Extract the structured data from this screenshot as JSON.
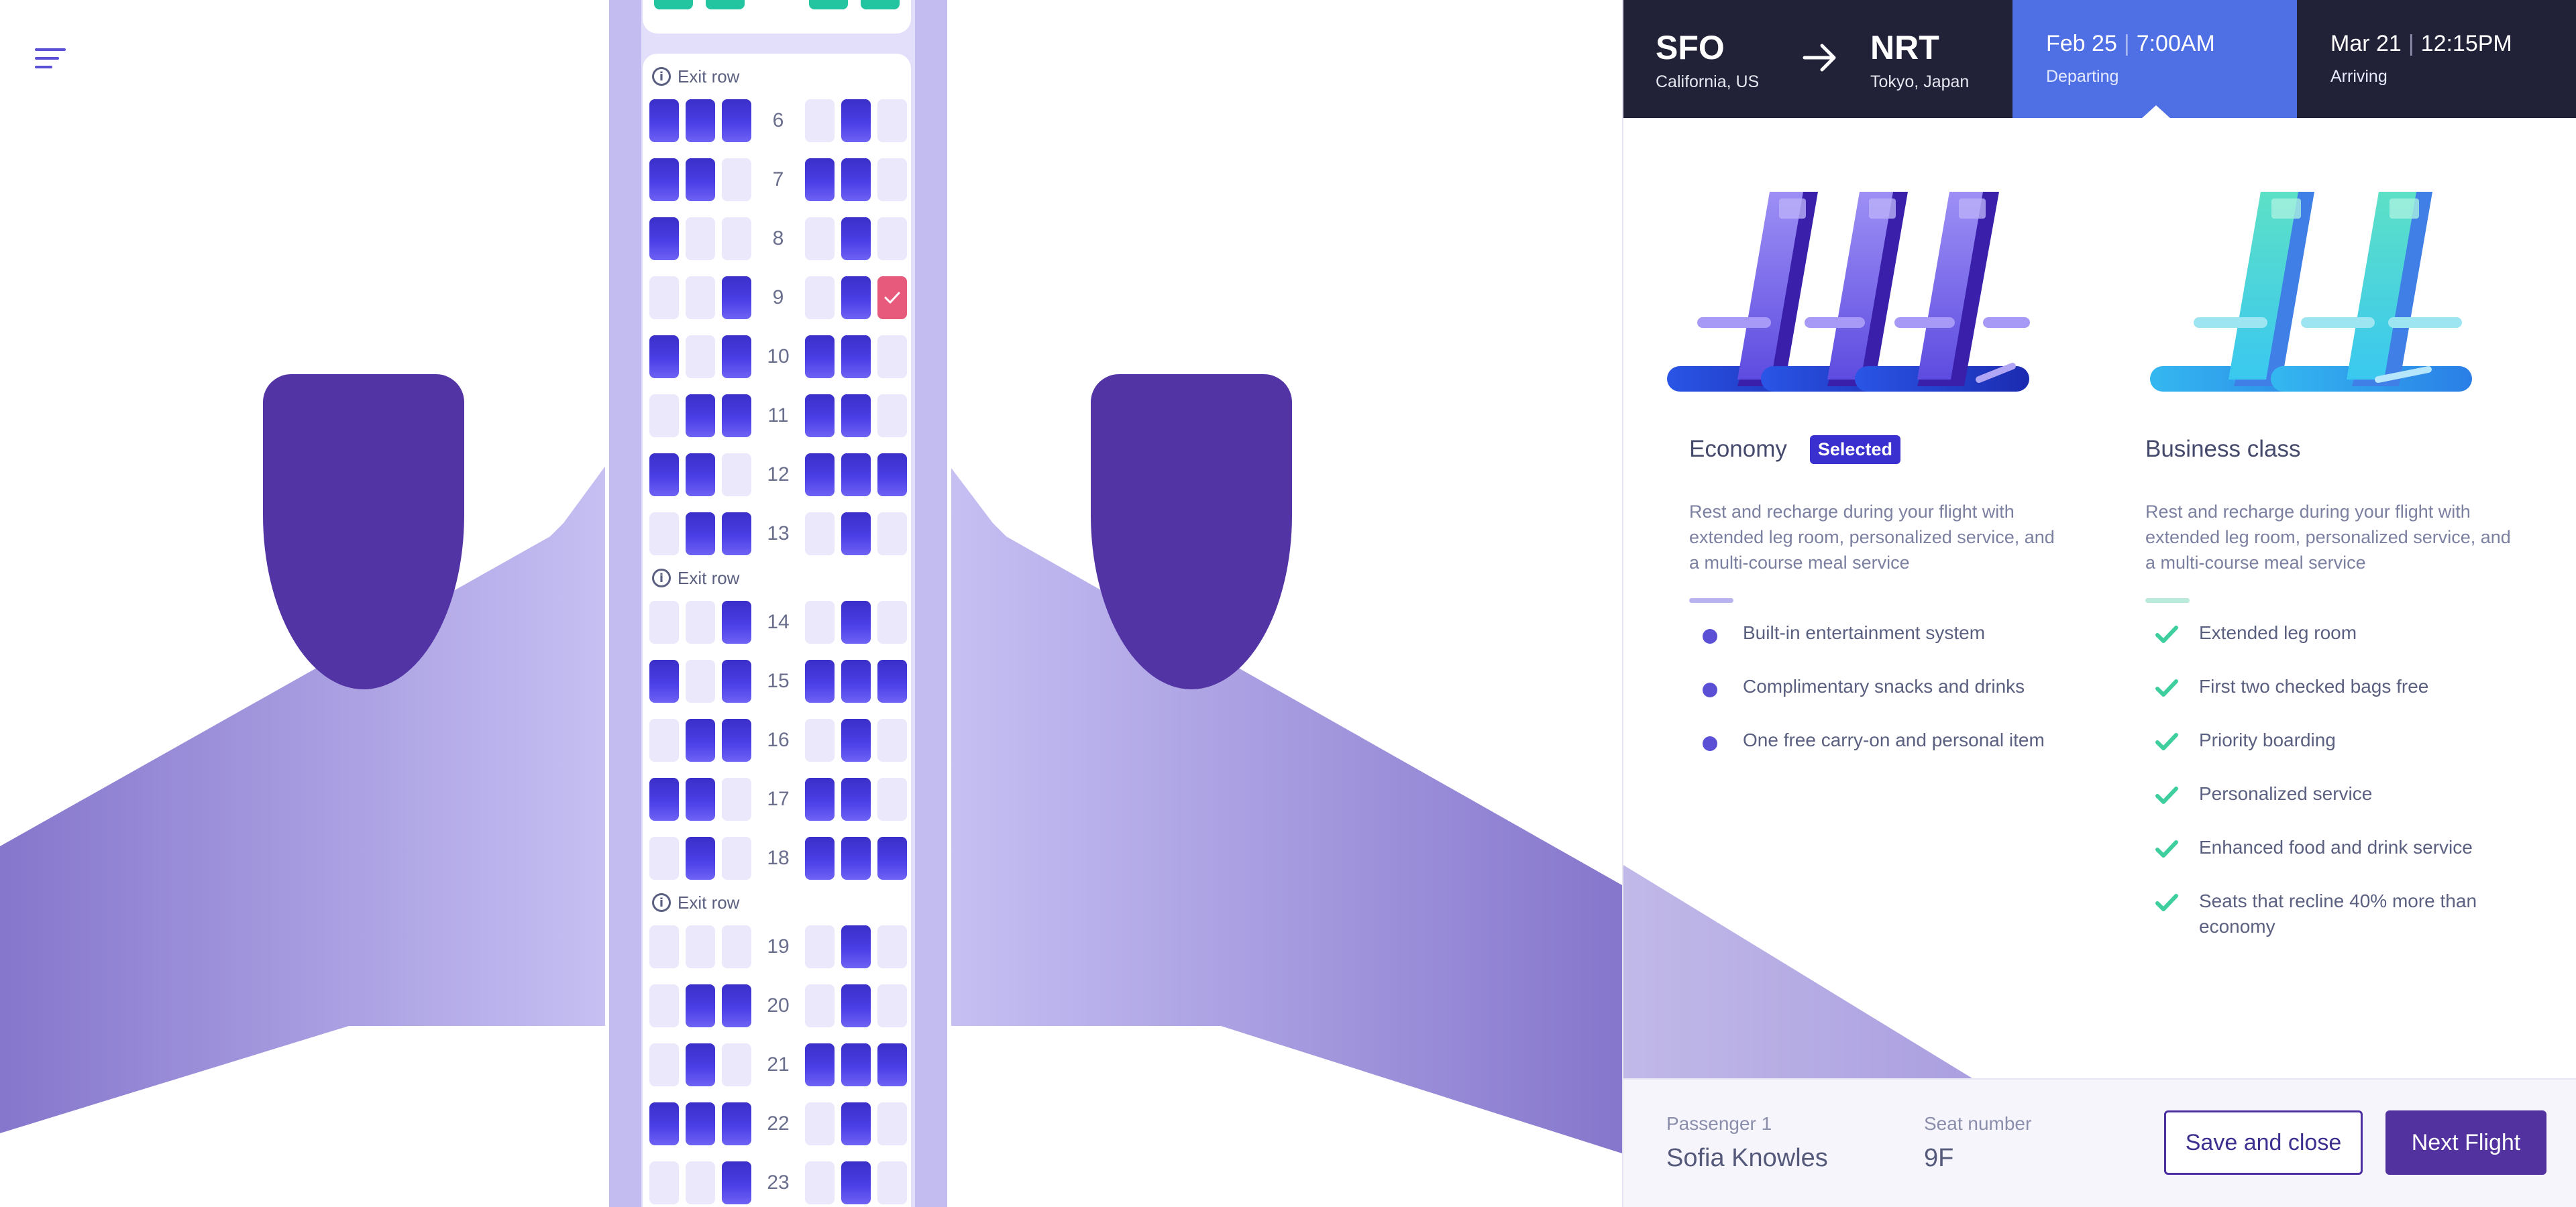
{
  "menu": {
    "icon": "hamburger-menu-icon"
  },
  "seat_map": {
    "exit_label": "Exit row",
    "selected_mark_icon": "check-icon",
    "colors": {
      "taken": "#4a3ee6",
      "free": "#ebe8fb",
      "selected": "#e85a7c",
      "exit_mini_seats": "#23c5a0"
    },
    "rows": [
      {
        "num": "6",
        "seats": [
          "T",
          "T",
          "T",
          "F",
          "T",
          "F"
        ]
      },
      {
        "num": "7",
        "seats": [
          "T",
          "T",
          "F",
          "T",
          "T",
          "F"
        ]
      },
      {
        "num": "8",
        "seats": [
          "T",
          "F",
          "F",
          "F",
          "T",
          "F"
        ]
      },
      {
        "num": "9",
        "seats": [
          "F",
          "F",
          "T",
          "F",
          "T",
          "S"
        ]
      },
      {
        "num": "10",
        "seats": [
          "T",
          "F",
          "T",
          "T",
          "T",
          "F"
        ]
      },
      {
        "num": "11",
        "seats": [
          "F",
          "T",
          "T",
          "T",
          "T",
          "F"
        ]
      },
      {
        "num": "12",
        "seats": [
          "T",
          "T",
          "F",
          "T",
          "T",
          "T"
        ]
      },
      {
        "num": "13",
        "seats": [
          "F",
          "T",
          "T",
          "F",
          "T",
          "F"
        ]
      },
      {
        "num": "14",
        "seats": [
          "F",
          "F",
          "T",
          "F",
          "T",
          "F"
        ]
      },
      {
        "num": "15",
        "seats": [
          "T",
          "F",
          "T",
          "T",
          "T",
          "T"
        ]
      },
      {
        "num": "16",
        "seats": [
          "F",
          "T",
          "T",
          "F",
          "T",
          "F"
        ]
      },
      {
        "num": "17",
        "seats": [
          "T",
          "T",
          "F",
          "T",
          "T",
          "F"
        ]
      },
      {
        "num": "18",
        "seats": [
          "F",
          "T",
          "F",
          "T",
          "T",
          "T"
        ]
      },
      {
        "num": "19",
        "seats": [
          "F",
          "F",
          "F",
          "F",
          "T",
          "F"
        ]
      },
      {
        "num": "20",
        "seats": [
          "F",
          "T",
          "T",
          "F",
          "T",
          "F"
        ]
      },
      {
        "num": "21",
        "seats": [
          "F",
          "T",
          "F",
          "T",
          "T",
          "T"
        ]
      },
      {
        "num": "22",
        "seats": [
          "T",
          "T",
          "T",
          "F",
          "T",
          "F"
        ]
      },
      {
        "num": "23",
        "seats": [
          "F",
          "F",
          "T",
          "F",
          "T",
          "F"
        ]
      }
    ]
  },
  "header": {
    "from": {
      "code": "SFO",
      "city": "California, US"
    },
    "to": {
      "code": "NRT",
      "city": "Tokyo, Japan"
    },
    "arrow_icon": "arrow-right-icon",
    "departing": {
      "date": "Feb 25",
      "time": "7:00AM",
      "label": "Departing"
    },
    "arriving": {
      "date": "Mar 21",
      "time": "12:15PM",
      "label": "Arriving"
    },
    "colors": {
      "bar": "#212138",
      "active": "#4f6fe4"
    }
  },
  "classes": {
    "economy": {
      "title": "Economy",
      "badge": "Selected",
      "description": "Rest and recharge during your flight with extended leg room, personalized service, and a multi-course meal service",
      "features": [
        "Built-in entertainment system",
        "Complimentary snacks and drinks",
        "One free carry-on and personal item"
      ],
      "bullet_icon": "dot-icon"
    },
    "business": {
      "title": "Business class",
      "description": "Rest and recharge during your flight with extended leg room, personalized service, and a multi-course meal service",
      "features": [
        "Extended leg room",
        "First two checked bags free",
        "Priority boarding",
        "Personalized service",
        "Enhanced food and drink service",
        "Seats that recline 40% more than economy"
      ],
      "bullet_icon": "check-icon"
    }
  },
  "footer": {
    "passenger_label": "Passenger 1",
    "passenger_name": "Sofia Knowles",
    "seat_label": "Seat number",
    "seat_value": "9F",
    "save_label": "Save and close",
    "next_label": "Next Flight"
  }
}
